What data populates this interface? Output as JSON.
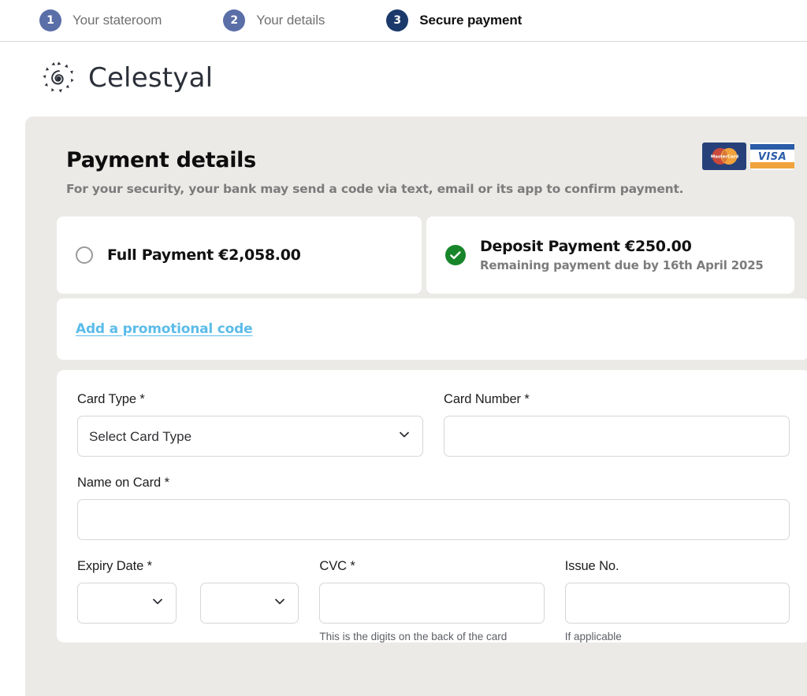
{
  "steps": [
    {
      "number": "1",
      "label": "Your stateroom",
      "state": "inactive"
    },
    {
      "number": "2",
      "label": "Your details",
      "state": "inactive"
    },
    {
      "number": "3",
      "label": "Secure payment",
      "state": "active"
    }
  ],
  "brand": {
    "name": "Celestyal",
    "mark_icon": "celestyal-sun-spiral-icon"
  },
  "payment": {
    "title": "Payment details",
    "subtitle": "For your security, your bank may send a code via text, email or its app to confirm payment.",
    "card_logos": [
      {
        "name": "mastercard-logo",
        "label": "MasterCard"
      },
      {
        "name": "visa-logo",
        "label": "VISA"
      }
    ],
    "options": [
      {
        "id": "full",
        "label": "Full Payment",
        "amount": "€2,058.00",
        "selected": false,
        "indicator_icon": "radio-unchecked-icon"
      },
      {
        "id": "deposit",
        "label": "Deposit Payment",
        "amount": "€250.00",
        "note": "Remaining payment due by 16th April 2025",
        "selected": true,
        "indicator_icon": "check-circle-icon"
      }
    ],
    "promo_link": "Add a promotional code"
  },
  "form": {
    "card_type": {
      "label": "Card Type *",
      "value": "Select Card Type",
      "chevron_icon": "chevron-down-icon"
    },
    "card_number": {
      "label": "Card Number *",
      "value": "",
      "placeholder": ""
    },
    "name_on_card": {
      "label": "Name on Card *",
      "value": "",
      "placeholder": ""
    },
    "expiry": {
      "label": "Expiry Date *",
      "month_value": "",
      "year_value": "",
      "chevron_icon": "chevron-down-icon"
    },
    "cvc": {
      "label": "CVC *",
      "value": "",
      "placeholder": "",
      "hint": "This is the digits on the back of the card"
    },
    "issue_no": {
      "label": "Issue No.",
      "value": "",
      "placeholder": "",
      "hint": "If applicable"
    }
  },
  "colors": {
    "step_inactive": "#5a6ea8",
    "step_active": "#1b3a6b",
    "panel_bg": "#eceae7",
    "link": "#5bbcea",
    "check_green": "#17862a"
  }
}
